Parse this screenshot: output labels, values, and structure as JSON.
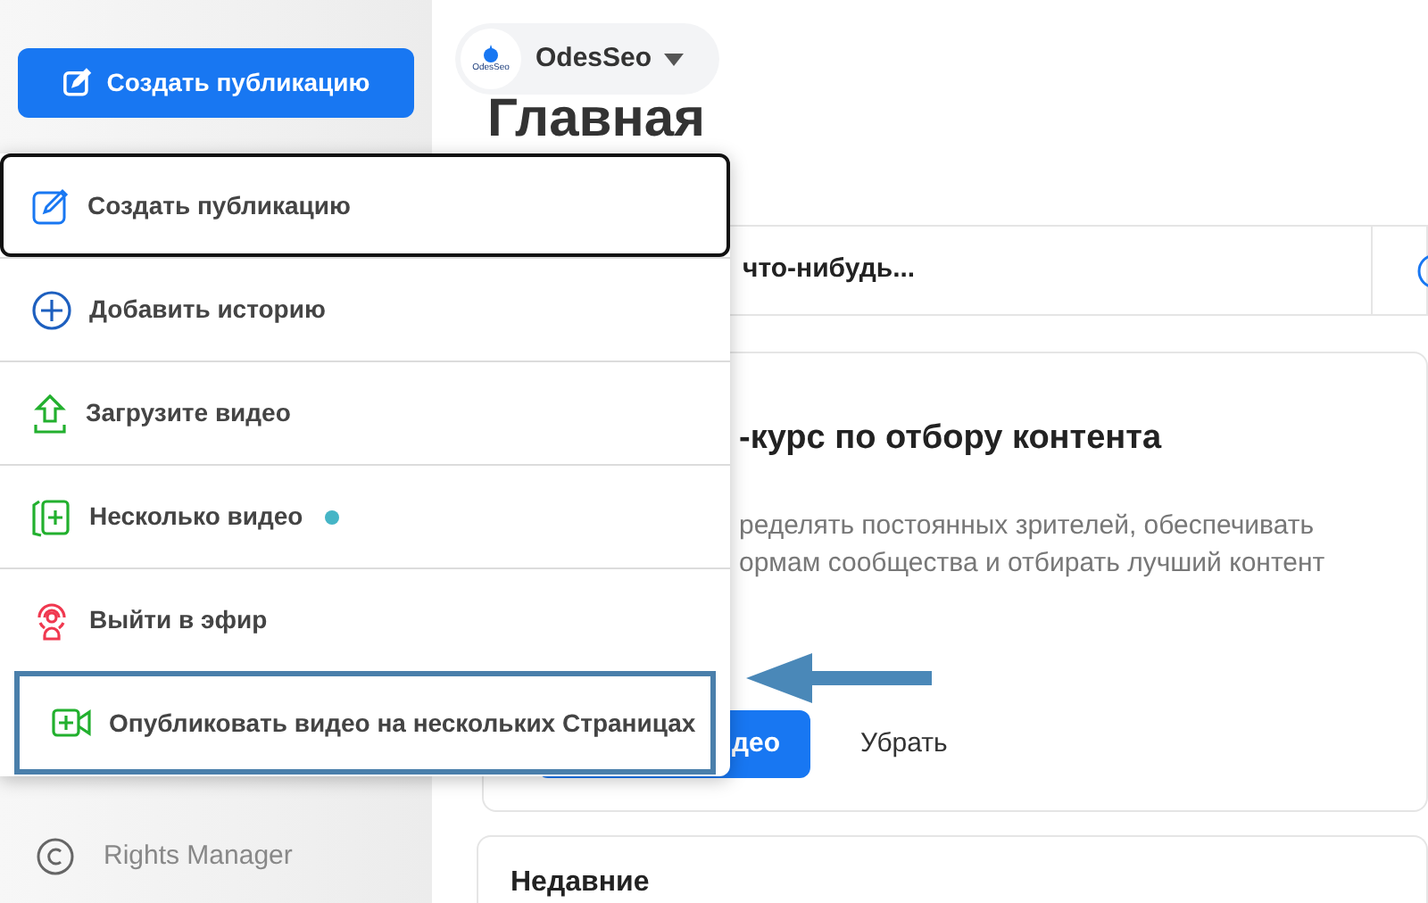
{
  "sidebar": {
    "create_button": "Создать публикацию",
    "items": [
      {
        "label": "Rights Manager"
      }
    ]
  },
  "menu": {
    "items": [
      {
        "kind": "post",
        "label": "Создать публикацию",
        "focused": true,
        "new": false,
        "highlighted": false
      },
      {
        "kind": "story",
        "label": "Добавить историю",
        "focused": false,
        "new": false,
        "highlighted": false
      },
      {
        "kind": "upload",
        "label": "Загрузите видео",
        "focused": false,
        "new": false,
        "highlighted": false
      },
      {
        "kind": "multi",
        "label": "Несколько видео",
        "focused": false,
        "new": true,
        "highlighted": false
      },
      {
        "kind": "live",
        "label": "Выйти в эфир",
        "focused": false,
        "new": false,
        "highlighted": false
      },
      {
        "kind": "crosspost",
        "label": "Опубликовать видео на нескольких Страницах",
        "focused": false,
        "new": false,
        "highlighted": true
      }
    ]
  },
  "page_switcher": {
    "logo_caption": "OdesSeo",
    "name": "OdesSeo"
  },
  "title": "Главная",
  "composer": {
    "placeholder": "что-нибудь..."
  },
  "course_card": {
    "title": "-курс по отбору контента",
    "lines": [
      "ределять постоянных зрителей, обеспечивать",
      "ормам сообщества и отбирать лучший контент"
    ],
    "primary_button": "део",
    "secondary_button": "Убрать"
  },
  "recent": {
    "title": "Недавние"
  }
}
